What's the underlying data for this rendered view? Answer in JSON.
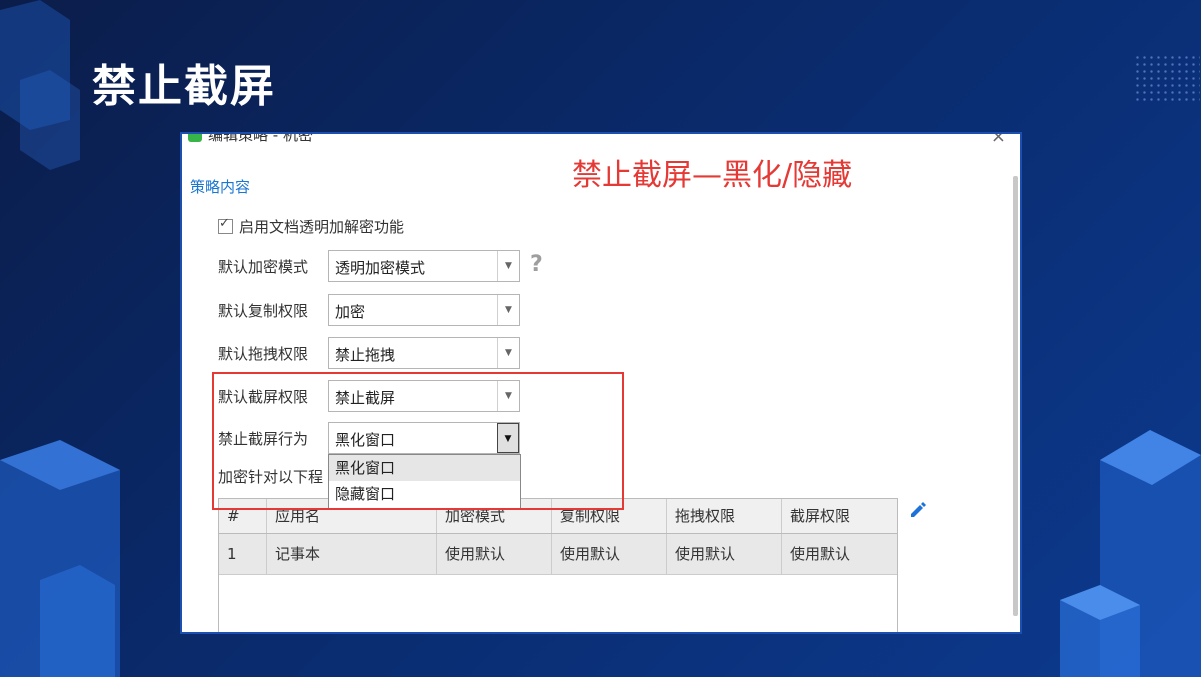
{
  "slide": {
    "title": "禁止截屏"
  },
  "window": {
    "title": "编辑策略 - 机密",
    "close": "×"
  },
  "note": "禁止截屏—黑化/隐藏",
  "section_title": "策略内容",
  "checkbox": {
    "label": "启用文档透明加解密功能",
    "checked": true
  },
  "fields": {
    "encrypt_mode": {
      "label": "默认加密模式",
      "value": "透明加密模式"
    },
    "copy_perm": {
      "label": "默认复制权限",
      "value": "加密"
    },
    "drag_perm": {
      "label": "默认拖拽权限",
      "value": "禁止拖拽"
    },
    "screenshot_perm": {
      "label": "默认截屏权限",
      "value": "禁止截屏"
    },
    "screenshot_behavior": {
      "label": "禁止截屏行为",
      "value": "黑化窗口"
    }
  },
  "dropdown_options": [
    "黑化窗口",
    "隐藏窗口"
  ],
  "apply_label": "加密针对以下程",
  "table": {
    "headers": [
      "#",
      "应用名",
      "加密模式",
      "复制权限",
      "拖拽权限",
      "截屏权限"
    ],
    "rows": [
      [
        "1",
        "记事本",
        "使用默认",
        "使用默认",
        "使用默认",
        "使用默认"
      ]
    ]
  },
  "colors": {
    "accent": "#1976d2",
    "highlight": "#e53935",
    "background": "#0a2a6b"
  },
  "icons": {
    "help": "question-icon",
    "edit": "pencil-icon",
    "dropdown": "chevron-down-icon"
  }
}
